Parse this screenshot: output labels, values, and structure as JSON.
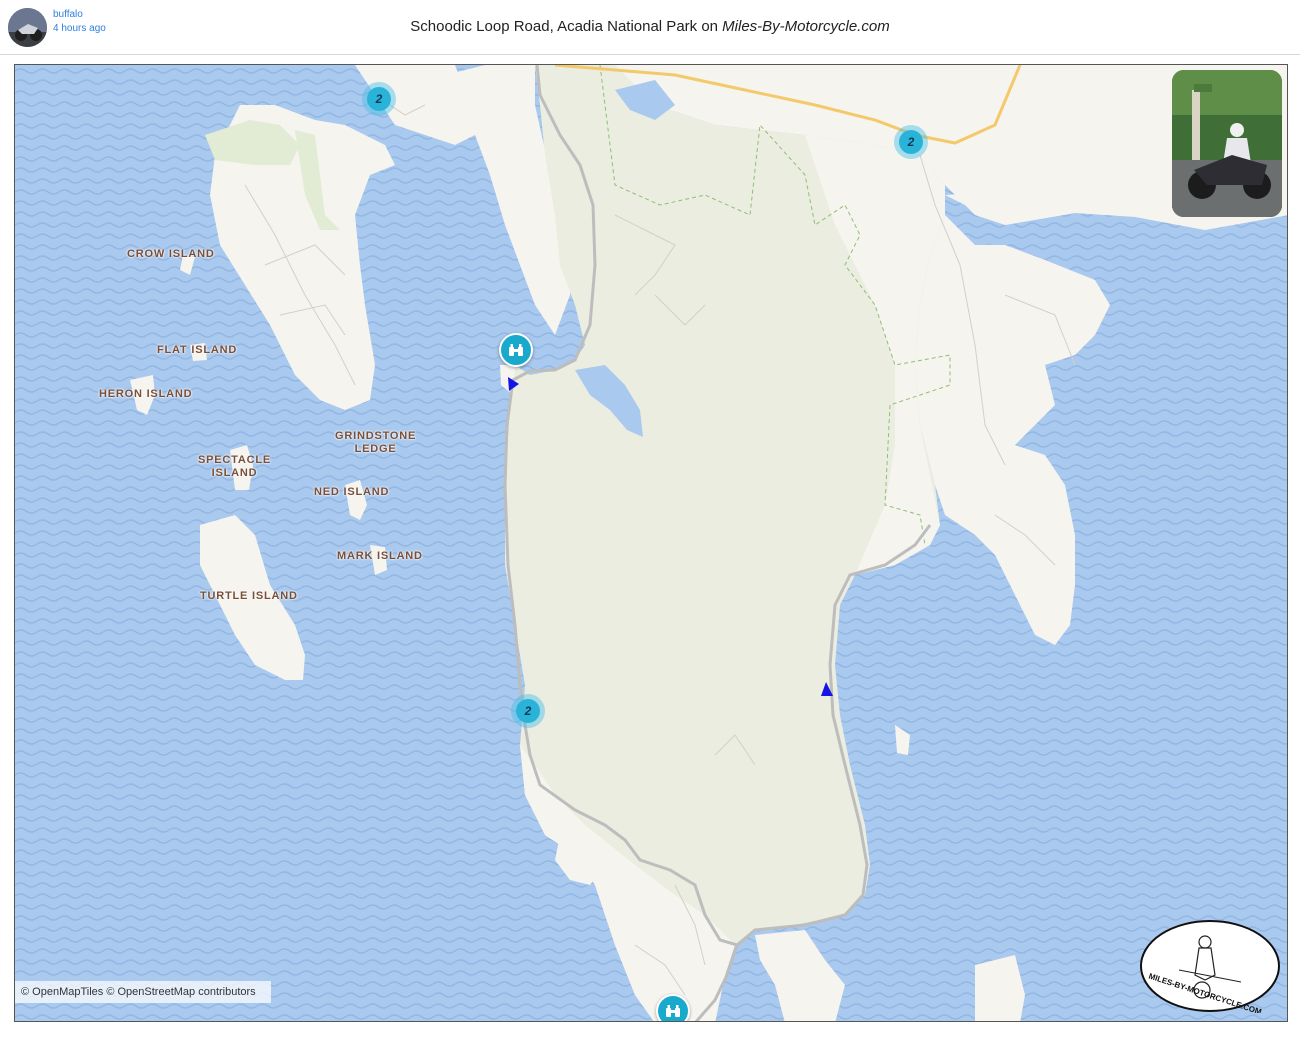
{
  "post": {
    "user": "buffalo",
    "time": "4 hours ago",
    "title_prefix": "Schoodic Loop Road, Acadia National Park on ",
    "title_site": "Miles-By-Motorcycle.com"
  },
  "map": {
    "labels": {
      "crow": "CROW ISLAND",
      "flat": "FLAT ISLAND",
      "heron": "HERON ISLAND",
      "grindstone_1": "GRINDSTONE",
      "grindstone_2": "LEDGE",
      "spectacle_1": "SPECTACLE",
      "spectacle_2": "ISLAND",
      "ned": "NED ISLAND",
      "mark": "MARK ISLAND",
      "turtle": "TURTLE ISLAND"
    },
    "clusters": [
      "2",
      "2",
      "2"
    ],
    "attribution": "© OpenMapTiles © OpenStreetMap contributors",
    "logo_text": "MILES-BY-MOTORCYCLE.COM",
    "colors": {
      "water": "#a9c9ee",
      "land": "#f6f4ee",
      "park": "#ebede0",
      "road": "#bdbdbd",
      "highway": "#f4c96b",
      "poi": "#19a9cc",
      "cluster": "#2ab3d9",
      "flag": "#1414e6"
    }
  }
}
